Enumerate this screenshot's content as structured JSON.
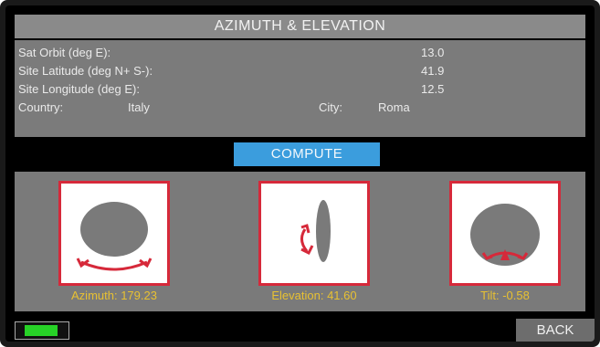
{
  "screen": {
    "title": "AZIMUTH & ELEVATION",
    "fields": [
      {
        "label": "Sat Orbit (deg E):",
        "value": "13.0"
      },
      {
        "label": "Site Latitude (deg N+ S-):",
        "value": "41.9"
      },
      {
        "label": "Site Longitude (deg E):",
        "value": "12.5"
      }
    ],
    "country_label": "Country:",
    "country_value": "Italy",
    "city_label": "City:",
    "city_value": "Roma",
    "compute_label": "COMPUTE",
    "azimuth_caption": "Azimuth: 179.23",
    "elevation_caption": "Elevation: 41.60",
    "tilt_caption": "Tilt: -0.58",
    "back_label": "BACK"
  },
  "colors": {
    "title_bg": "#8a8a8a",
    "panel_bg": "#7b7b7b",
    "compute_bg": "#3b9ddd",
    "accent_red": "#d6293a",
    "caption_yellow": "#e8c132",
    "battery_green": "#27d227"
  },
  "icons": {
    "azimuth": "azimuth-rotation-icon",
    "elevation": "elevation-rotation-icon",
    "tilt": "tilt-rotation-icon",
    "battery": "battery-icon"
  }
}
